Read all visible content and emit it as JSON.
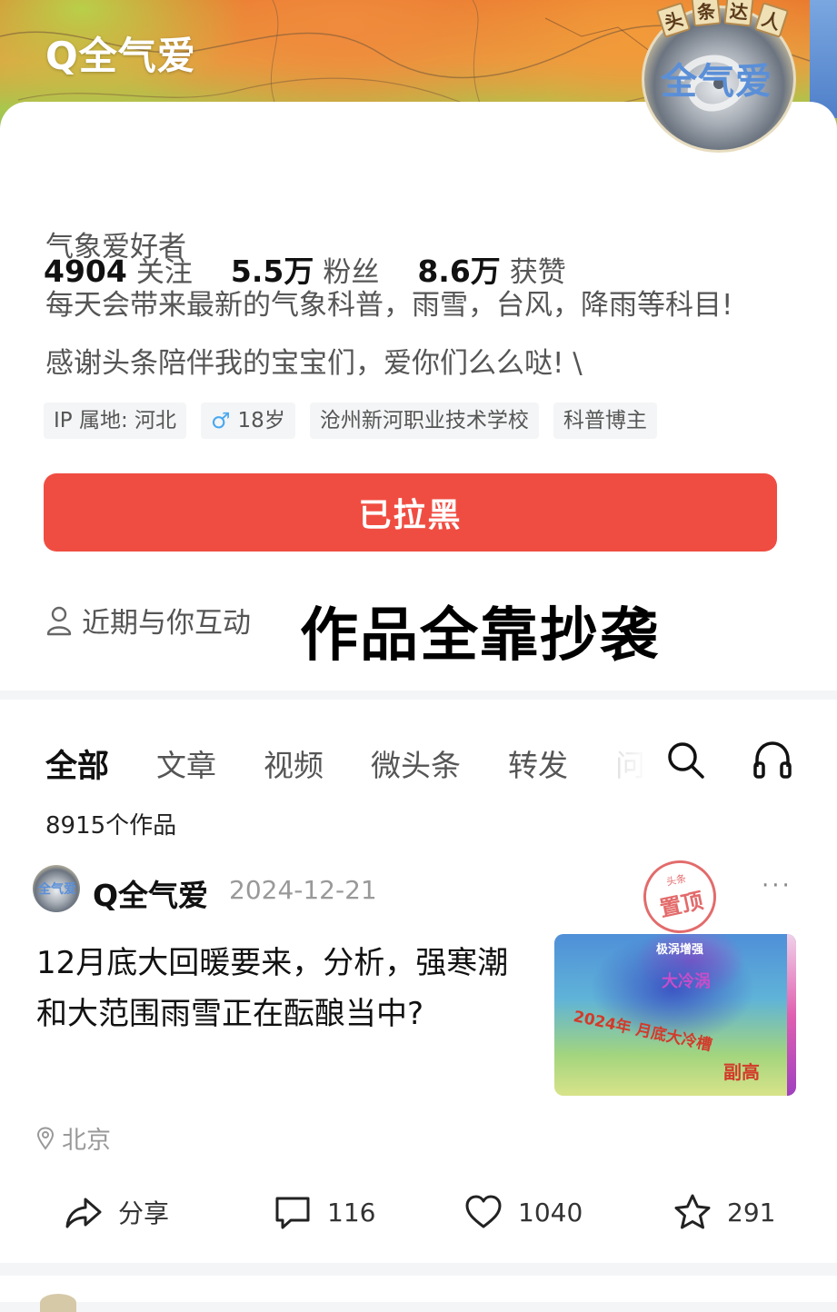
{
  "profile": {
    "username": "Q全气爱",
    "avatar_text": "全气爱",
    "badge_chars": [
      "头",
      "条",
      "达",
      "人"
    ],
    "stats": [
      {
        "num": "4904",
        "label": "关注"
      },
      {
        "num": "5.5万",
        "label": "粉丝"
      },
      {
        "num": "8.6万",
        "label": "获赞"
      }
    ],
    "bio_title": "气象爱好者",
    "bio_lines": [
      "每天会带来最新的气象科普，雨雪，台风，降雨等科目!",
      "感谢头条陪伴我的宝宝们，爱你们么么哒! \\"
    ],
    "tags": {
      "ip": "IP 属地: 河北",
      "gender_icon": "♂",
      "age": "18岁",
      "school": "沧州新河职业技术学校",
      "role": "科普博主"
    },
    "blocked_button": "已拉黑",
    "recent_interaction": "近期与你互动",
    "overlay_caption": "作品全靠抄袭"
  },
  "content": {
    "tabs": [
      "全部",
      "文章",
      "视频",
      "微头条",
      "转发",
      "问"
    ],
    "active_tab": "全部",
    "works_count": "8915个作品",
    "post": {
      "author": "Q全气爱",
      "date": "2024-12-21",
      "stamp_small": "头条",
      "stamp_big": "置顶",
      "more": "···",
      "title": "12月底大回暖要来，分析，强寒潮和大范围雨雪正在酝酿当中?",
      "thumb_texts": [
        "极涡增强",
        "大冷涡",
        "2024年 月底大冷槽",
        "副高"
      ],
      "location": "北京",
      "actions": {
        "share": "分享",
        "comments": "116",
        "likes": "1040",
        "favorites": "291"
      }
    }
  },
  "icons": {
    "search": "search-icon",
    "headphone": "headphone-icon",
    "person": "person-icon",
    "location": "location-pin-icon",
    "share": "share-icon",
    "comment": "comment-icon",
    "like": "heart-icon",
    "favorite": "star-icon"
  },
  "colors": {
    "accent_red": "#f04d42",
    "text_main": "#111111",
    "text_secondary": "#555555"
  }
}
